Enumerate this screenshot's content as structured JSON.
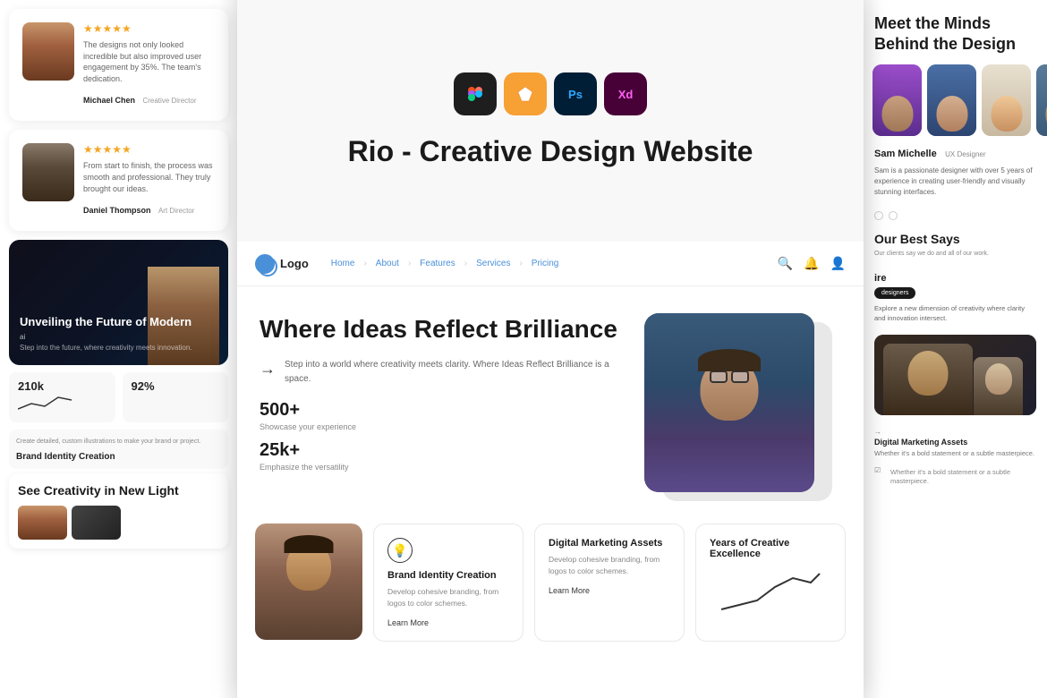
{
  "app": {
    "title": "Rio - Creative Design Website"
  },
  "left_panel": {
    "testimonial1": {
      "name": "Michael Chen",
      "role": "Creative Director",
      "stars": "★★★★★",
      "text": "The designs not only looked incredible but also improved user engagement by 35%. The team's dedication."
    },
    "testimonial2": {
      "name": "Daniel Thompson",
      "role": "Art Director",
      "stars": "★★★★★",
      "text": "From start to finish, the process was smooth and professional. They truly brought our ideas."
    },
    "banner": {
      "title": "Unveiling the Future of Modern",
      "subtitle": "ai",
      "desc": "Step into the future, where creativity meets innovation."
    },
    "stats": {
      "stat1": "210k",
      "stat2": "92%",
      "stat1_label": "Create detailed, custom illustrations to make your brand or project.",
      "stat2_label": ""
    },
    "brand_identity": {
      "label": "Brand Identity Creation"
    },
    "bottom": {
      "title": "See Creativity in New Light"
    }
  },
  "center_panel": {
    "tools": [
      {
        "name": "Figma",
        "label": "F"
      },
      {
        "name": "Sketch",
        "label": "S"
      },
      {
        "name": "Photoshop",
        "label": "Ps"
      },
      {
        "name": "XD",
        "label": "Xd"
      }
    ],
    "title": "Rio - Creative Design Website",
    "nav": {
      "logo": "Logo",
      "links": [
        "Home",
        "About",
        "Features",
        "Services",
        "Pricing"
      ]
    },
    "hero": {
      "title": "Where Ideas Reflect Brilliance",
      "description": "Step into a world where creativity meets clarity. Where Ideas Reflect Brilliance is a space.",
      "stat1_num": "500+",
      "stat1_label": "Showcase your experience",
      "stat2_num": "25k+",
      "stat2_label": "Emphasize the versatility"
    },
    "services": [
      {
        "title": "Brand Identity Creation",
        "desc": "Develop cohesive branding, from logos to color schemes.",
        "link": "Learn More"
      },
      {
        "title": "Digital Marketing Assets",
        "desc": "Develop cohesive branding, from logos to color schemes.",
        "link": "Learn More"
      },
      {
        "title": "Years of Creative Excellence",
        "desc": ""
      }
    ]
  },
  "right_panel": {
    "section_title": "Meet the Minds Behind the Design",
    "profile": {
      "name": "Sam Michelle",
      "role": "UX Designer",
      "desc": "Sam is a passionate designer with over 5 years of experience in creating user-friendly and visually stunning interfaces."
    },
    "reviews_title": "Our Best Says",
    "reviews_desc": "Our clients say we do and all of our work.",
    "section_label": "ire",
    "tags": [
      "designers"
    ],
    "explore_text": "Explore a new dimension of creativity where clarity and innovation intersect.",
    "bottom_items": [
      {
        "title": "Digital Marketing Assets",
        "desc": "Whether it's a bold statement or a subtle masterpiece."
      }
    ]
  }
}
